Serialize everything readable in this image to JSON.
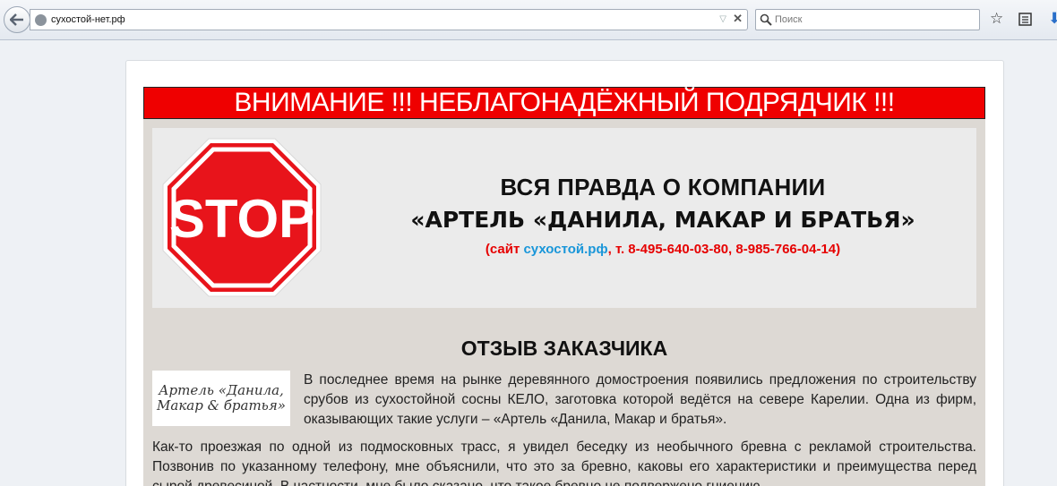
{
  "browser": {
    "url": "сухостой-нет.рф",
    "search_placeholder": "Поиск",
    "icons": [
      "back-arrow-icon",
      "globe-icon",
      "dropdown-icon",
      "close-icon",
      "search-icon",
      "star-icon",
      "bookmarks-icon",
      "download-icon"
    ]
  },
  "page": {
    "banner": "ВНИМАНИЕ !!! НЕБЛАГОНАДЁЖНЫЙ ПОДРЯДЧИК !!!",
    "stop_text": "STOP",
    "heading_line1": "ВСЯ ПРАВДА О КОМПАНИИ",
    "heading_line2": "«АРТЕЛЬ «ДАНИЛА, МАКАР И БРАТЬЯ»",
    "contact_prefix": "(сайт ",
    "contact_site": "сухостой.рф",
    "contact_suffix": ", т. 8-495-640-03-80, 8-985-766-04-14)",
    "review_title": "ОТЗЫВ ЗАКАЗЧИКА",
    "logo_line1": "Артель «Данила,",
    "logo_line2": "Макар & братья»",
    "paragraph1": "В последнее время на рынке деревянного домостроения появились предложения по строительству срубов из сухостойной сосны КЕЛО, заготовка которой ведётся на севере Карелии. Одна из фирм, оказывающих такие услуги – «Артель «Данила, Макар и братья».",
    "paragraph2": "Как-то проезжая по одной из подмосковных трасс, я увидел беседку из необычного бревна с рекламой строительства. Позвонив по указанному телефону, мне объяснили, что это за бревно, каковы его характеристики и преимущества перед сырой древесиной. В частности, мне было сказано, что такое бревно не подвержено гниению."
  },
  "colors": {
    "banner_bg": "#ef0000",
    "stop_red": "#e8141b",
    "contact_red": "#e60000",
    "link_blue": "#1996d9",
    "panel_beige": "#ddd9d4"
  }
}
